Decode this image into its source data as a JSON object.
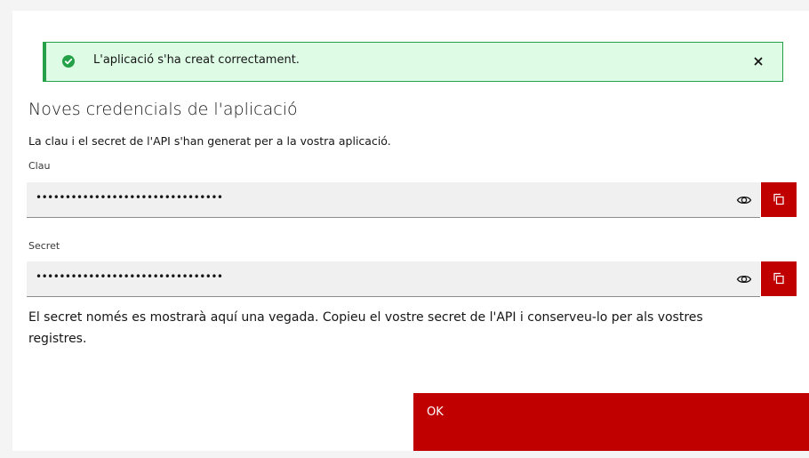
{
  "notification": {
    "message": "L'aplicació s'ha creat correctament.",
    "status_icon": "checkmark-filled-icon",
    "close_icon": "close-icon",
    "color": "#24a148"
  },
  "title": "Noves credencials de l'aplicació",
  "description": "La clau i el secret de l'API s'han generat per a la vostra aplicació.",
  "key_field": {
    "label": "Clau",
    "value": "••••••••••••••••••••••••••••••••",
    "visibility_icon": "eye-icon",
    "copy_icon": "copy-icon"
  },
  "secret_field": {
    "label": "Secret",
    "value": "••••••••••••••••••••••••••••••••",
    "visibility_icon": "eye-icon",
    "copy_icon": "copy-icon"
  },
  "note": "El secret només es mostrarà aquí una vegada. Copieu el vostre secret de l'API i conserveu-lo per als vostres registres.",
  "ok_button": {
    "label": "OK"
  },
  "colors": {
    "accent": "#c00000",
    "success": "#24a148",
    "success_bg": "#defbe6"
  }
}
